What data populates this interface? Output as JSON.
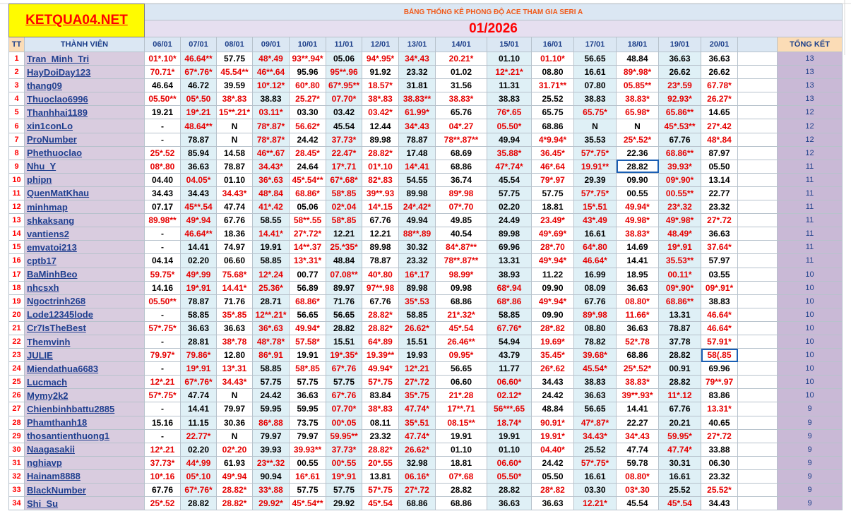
{
  "logo": "KETQUA04.NET",
  "title": "BẢNG THỐNG KÊ PHONG ĐỘ ACE THAM GIA SERI A",
  "month": "01/2026",
  "headers": {
    "tt": "TT",
    "member": "THÀNH VIÊN",
    "total": "TỔNG KẾT"
  },
  "dates": [
    "06/01",
    "07/01",
    "08/01",
    "09/01",
    "10/01",
    "11/01",
    "12/01",
    "13/01",
    "14/01",
    "15/01",
    "16/01",
    "17/01",
    "18/01",
    "19/01",
    "20/01"
  ],
  "rows": [
    {
      "tt": "1",
      "name": "Tran_Minh_Tri",
      "vals": [
        "01*.10*",
        "46.64**",
        "57.75",
        "48*.49",
        "93**.94*",
        "05.06",
        "94*.95*",
        "34*.43",
        "20.21*",
        "01.10",
        "01.10*",
        "56.65",
        "48.84",
        "36.63",
        "36.63"
      ],
      "total": "13"
    },
    {
      "tt": "2",
      "name": "HayDoiDay123",
      "vals": [
        "70.71*",
        "67*.76*",
        "45.54**",
        "46**.64",
        "95.96",
        "95**.96",
        "91.92",
        "23.32",
        "01.02",
        "12*.21*",
        "08.80",
        "16.61",
        "89*.98*",
        "26.62",
        "26.62"
      ],
      "total": "13"
    },
    {
      "tt": "3",
      "name": "thang09",
      "vals": [
        "46.64",
        "46.72",
        "39.59",
        "10*.12*",
        "60*.80",
        "67*.95**",
        "18.57*",
        "31.81",
        "31.56",
        "11.31",
        "31.71**",
        "07.80",
        "05.85**",
        "23*.59",
        "67.78*"
      ],
      "total": "13"
    },
    {
      "tt": "4",
      "name": "Thuoclao6996",
      "vals": [
        "05.50**",
        "05*.50",
        "38*.83",
        "38.83",
        "25.27*",
        "07.70*",
        "38*.83",
        "38.83**",
        "38.83*",
        "38.83",
        "25.52",
        "38.83",
        "38.83*",
        "92.93*",
        "26.27*"
      ],
      "total": "13"
    },
    {
      "tt": "5",
      "name": "Thanhhai1189",
      "vals": [
        "19.21",
        "19*.21",
        "15**.21*",
        "03.11*",
        "03.30",
        "03.42",
        "03.42*",
        "61.99*",
        "65.76",
        "76*.65",
        "65.75",
        "65.75*",
        "65.98*",
        "65.86**",
        "14.65"
      ],
      "total": "12"
    },
    {
      "tt": "6",
      "name": "xin1conLo",
      "vals": [
        "-",
        "48.64**",
        "N",
        "78*.87*",
        "56.62*",
        "45.54",
        "12.44",
        "34*.43",
        "04*.27",
        "05.50*",
        "68.86",
        "N",
        "N",
        "45*.53**",
        "27*.42"
      ],
      "total": "12"
    },
    {
      "tt": "7",
      "name": "ProNumber",
      "vals": [
        "-",
        "78.87",
        "N",
        "78*.87*",
        "24.42",
        "37.73*",
        "89.98",
        "78.87",
        "78**.87**",
        "49.94",
        "4*9.94*",
        "35.53",
        "25*.52*",
        "67.76",
        "48*.84"
      ],
      "total": "12"
    },
    {
      "tt": "8",
      "name": "Phethuoclao",
      "vals": [
        "25*.52",
        "85.94",
        "14.58",
        "46**.67",
        "28.45*",
        "22.47*",
        "28.82*",
        "17.48",
        "68.69",
        "35.88*",
        "36.45*",
        "57*.75*",
        "22.36",
        "68.86**",
        "87.97"
      ],
      "total": "12"
    },
    {
      "tt": "9",
      "name": "Nhu_Y",
      "vals": [
        "08*.80",
        "36.63",
        "78.87",
        "34.43*",
        "24.64",
        "17*.71",
        "01*.10",
        "14*.41",
        "68.86",
        "47*.74*",
        "46*.64",
        "19.91**",
        "28.82",
        "39.93*",
        "05.50"
      ],
      "total": "11"
    },
    {
      "tt": "10",
      "name": "phipn",
      "vals": [
        "04.40",
        "04.05*",
        "01.10",
        "36*.63",
        "45*.54**",
        "67*.68*",
        "82*.83",
        "54.55",
        "36.74",
        "45.54",
        "79*.97",
        "29.39",
        "09.90",
        "09*.90*",
        "13.14"
      ],
      "total": "11"
    },
    {
      "tt": "11",
      "name": "QuenMatKhau",
      "vals": [
        "34.43",
        "34.43",
        "34.43*",
        "48*.84",
        "68.86*",
        "58*.85",
        "39**.93",
        "89.98",
        "89*.98",
        "57.75",
        "57.75",
        "57*.75*",
        "00.55",
        "00.55**",
        "22.77"
      ],
      "total": "11"
    },
    {
      "tt": "12",
      "name": "minhmap",
      "vals": [
        "07.17",
        "45**.54",
        "47.74",
        "41*.42",
        "05.06",
        "02*.04",
        "14*.15",
        "24*.42*",
        "07*.70",
        "02.20",
        "18.81",
        "15*.51",
        "49.94*",
        "23*.32",
        "23.32"
      ],
      "total": "11"
    },
    {
      "tt": "13",
      "name": "shkaksang",
      "vals": [
        "89.98**",
        "49*.94",
        "67.76",
        "58.55",
        "58**.55",
        "58*.85",
        "67.76",
        "49.94",
        "49.85",
        "24.49",
        "23.49*",
        "43*.49",
        "49.98*",
        "49*.98*",
        "27*.72"
      ],
      "total": "11"
    },
    {
      "tt": "14",
      "name": "vantiens2",
      "vals": [
        "-",
        "46.64**",
        "18.36",
        "14.41*",
        "27*.72*",
        "12.21",
        "12.21",
        "88**.89",
        "40.54",
        "89.98",
        "49*.69*",
        "16.61",
        "38.83*",
        "48.49*",
        "36.63"
      ],
      "total": "11"
    },
    {
      "tt": "15",
      "name": "emvatoi213",
      "vals": [
        "-",
        "14.41",
        "74.97",
        "19.91",
        "14**.37",
        "25.*35*",
        "89.98",
        "30.32",
        "84*.87**",
        "69.96",
        "28*.70",
        "64*.80",
        "14.69",
        "19*.91",
        "37.64*"
      ],
      "total": "11"
    },
    {
      "tt": "16",
      "name": "cptb17",
      "vals": [
        "04.14",
        "02.20",
        "06.60",
        "58.85",
        "13*.31*",
        "48.84",
        "78.87",
        "23.32",
        "78**.87**",
        "13.31",
        "49*.94*",
        "46.64*",
        "14.41",
        "35.53**",
        "57.97"
      ],
      "total": "11"
    },
    {
      "tt": "17",
      "name": "BaMinhBeo",
      "vals": [
        "59.75*",
        "49*.99",
        "75.68*",
        "12*.24",
        "00.77",
        "07.08**",
        "40*.80",
        "16*.17",
        "98.99*",
        "38.93",
        "11.22",
        "16.99",
        "18.95",
        "00.11*",
        "03.55"
      ],
      "total": "10"
    },
    {
      "tt": "18",
      "name": "nhcsxh",
      "vals": [
        "14.16",
        "19*.91",
        "14.41*",
        "25.36*",
        "56.89",
        "89.97",
        "97**.98",
        "89.98",
        "09.98",
        "68*.94",
        "09.90",
        "08.09",
        "36.63",
        "09*.90*",
        "09*.91*"
      ],
      "total": "10"
    },
    {
      "tt": "19",
      "name": "Ngoctrinh268",
      "vals": [
        "05.50**",
        "78.87",
        "71.76",
        "28.71",
        "68.86*",
        "71.76",
        "67.76",
        "35*.53",
        "68.86",
        "68*.86",
        "49*.94*",
        "67.76",
        "08.80*",
        "68.86**",
        "38.83"
      ],
      "total": "10"
    },
    {
      "tt": "20",
      "name": "Lode12345lode",
      "vals": [
        "-",
        "58.85",
        "35*.85",
        "12**.21*",
        "56.65",
        "56.65",
        "28.82*",
        "58.85",
        "21*.32*",
        "58.85",
        "09.90",
        "89*.98",
        "11.66*",
        "13.31",
        "46.64*"
      ],
      "total": "10"
    },
    {
      "tt": "21",
      "name": "Cr7IsTheBest",
      "vals": [
        "57*.75*",
        "36.63",
        "36.63",
        "36*.63",
        "49.94*",
        "28.82",
        "28.82*",
        "26.62*",
        "45*.54",
        "67.76*",
        "28*.82",
        "08.80",
        "36.63",
        "78.87",
        "46.64*"
      ],
      "total": "10"
    },
    {
      "tt": "22",
      "name": "Themvinh",
      "vals": [
        "-",
        "28.81",
        "38*.78",
        "48*.78*",
        "57.58*",
        "15.51",
        "64*.89",
        "15.51",
        "26.46**",
        "54.94",
        "19.69*",
        "78.82",
        "52*.78",
        "37.78",
        "57.91*"
      ],
      "total": "10"
    },
    {
      "tt": "23",
      "name": "JULIE",
      "vals": [
        "79.97*",
        "79.86*",
        "12.80",
        "86*.91",
        "19.91",
        "19*.35*",
        "19.39**",
        "19.93",
        "09.95*",
        "43.79",
        "35.45*",
        "39.68*",
        "68.86",
        "28.82",
        "58(.85"
      ],
      "total": "10"
    },
    {
      "tt": "24",
      "name": "Miendathua6683",
      "vals": [
        "-",
        "19*.91",
        "13*.31",
        "58.85",
        "58*.85",
        "67*.76",
        "49.94*",
        "12*.21",
        "56.65",
        "11.77",
        "26*.62",
        "45.54*",
        "25*.52*",
        "00.91",
        "69.96"
      ],
      "total": "10"
    },
    {
      "tt": "25",
      "name": "Lucmach",
      "vals": [
        "12*.21",
        "67*.76*",
        "34.43*",
        "57.75",
        "57.75",
        "57.75",
        "57*.75",
        "27*.72",
        "06.60",
        "06.60*",
        "34.43",
        "38.83",
        "38.83*",
        "28.82",
        "79**.97"
      ],
      "total": "10"
    },
    {
      "tt": "26",
      "name": "Mymy2k2",
      "vals": [
        "57*.75*",
        "47.74",
        "N",
        "24.42",
        "36.63",
        "67*.76",
        "83.84",
        "35*.75",
        "21*.28",
        "02.12*",
        "24.42",
        "36.63",
        "39**.93*",
        "11*.12",
        "83.86"
      ],
      "total": "10"
    },
    {
      "tt": "27",
      "name": "Chienbinhbattu2885",
      "vals": [
        "-",
        "14.41",
        "79.97",
        "59.95",
        "59.95",
        "07.70*",
        "38*.83",
        "47.74*",
        "17**.71",
        "56***.65",
        "48.84",
        "56.65",
        "14.41",
        "67.76",
        "13.31*"
      ],
      "total": "9"
    },
    {
      "tt": "28",
      "name": "Phamthanh18",
      "vals": [
        "15.16",
        "11.15",
        "30.36",
        "86*.88",
        "73.75",
        "00*.05",
        "08.11",
        "35*.51",
        "08.15**",
        "18.74*",
        "90.91*",
        "47*.87*",
        "22.27",
        "20.21",
        "40.65"
      ],
      "total": "9"
    },
    {
      "tt": "29",
      "name": "thosantienthuong1",
      "vals": [
        "-",
        "22.77*",
        "N",
        "79.97",
        "79.97",
        "59.95**",
        "23.32",
        "47.74*",
        "19.91",
        "19.91",
        "19.91*",
        "34.43*",
        "34*.43",
        "59.95*",
        "27*.72"
      ],
      "total": "9"
    },
    {
      "tt": "30",
      "name": "Naagasakii",
      "vals": [
        "12*.21",
        "02.20",
        "02*.20",
        "39.93",
        "39.93**",
        "37.73*",
        "28.82*",
        "26.62*",
        "01.10",
        "01.10",
        "04.40*",
        "25.52",
        "47.74",
        "47.74*",
        "33.88"
      ],
      "total": "9"
    },
    {
      "tt": "31",
      "name": "nghiavp",
      "vals": [
        "37.73*",
        "44*.99",
        "61.93",
        "23**.32",
        "00.55",
        "00*.55",
        "20*.55",
        "32.98",
        "18.81",
        "06.60*",
        "24.42",
        "57*.75*",
        "59.78",
        "30.31",
        "06.30"
      ],
      "total": "9"
    },
    {
      "tt": "32",
      "name": "Hainam8888",
      "vals": [
        "10*.16",
        "05*.10",
        "49*.94",
        "90.94",
        "16*.61",
        "19*.91",
        "13.81",
        "06.16*",
        "07*.68",
        "05.50*",
        "05.50",
        "16.61",
        "08.80*",
        "16.61",
        "23.32"
      ],
      "total": "9"
    },
    {
      "tt": "33",
      "name": "BlackNumber",
      "vals": [
        "67.76",
        "67*.76*",
        "28.82*",
        "33*.88",
        "57.75",
        "57.75",
        "57*.75",
        "27*.72",
        "28.82",
        "28.82",
        "28*.82",
        "03.30",
        "03*.30",
        "25.52",
        "25.52*"
      ],
      "total": "9"
    },
    {
      "tt": "34",
      "name": "Shi_Su",
      "vals": [
        "25*.52",
        "28.82",
        "28.82*",
        "29.92*",
        "45*.54**",
        "29.92",
        "45*.54",
        "68.86",
        "68.86",
        "36.63",
        "36.63",
        "12.21*",
        "45.54",
        "45*.54",
        "34.43"
      ],
      "total": "9"
    }
  ],
  "colors": {
    "red": "#e60000",
    "alt": "#dff0f6",
    "name_bg": "#d9ccdf",
    "total_bg": "#c9b9d6",
    "logo_bg": "#fffb00",
    "link_blue": "#1f3f8f"
  }
}
